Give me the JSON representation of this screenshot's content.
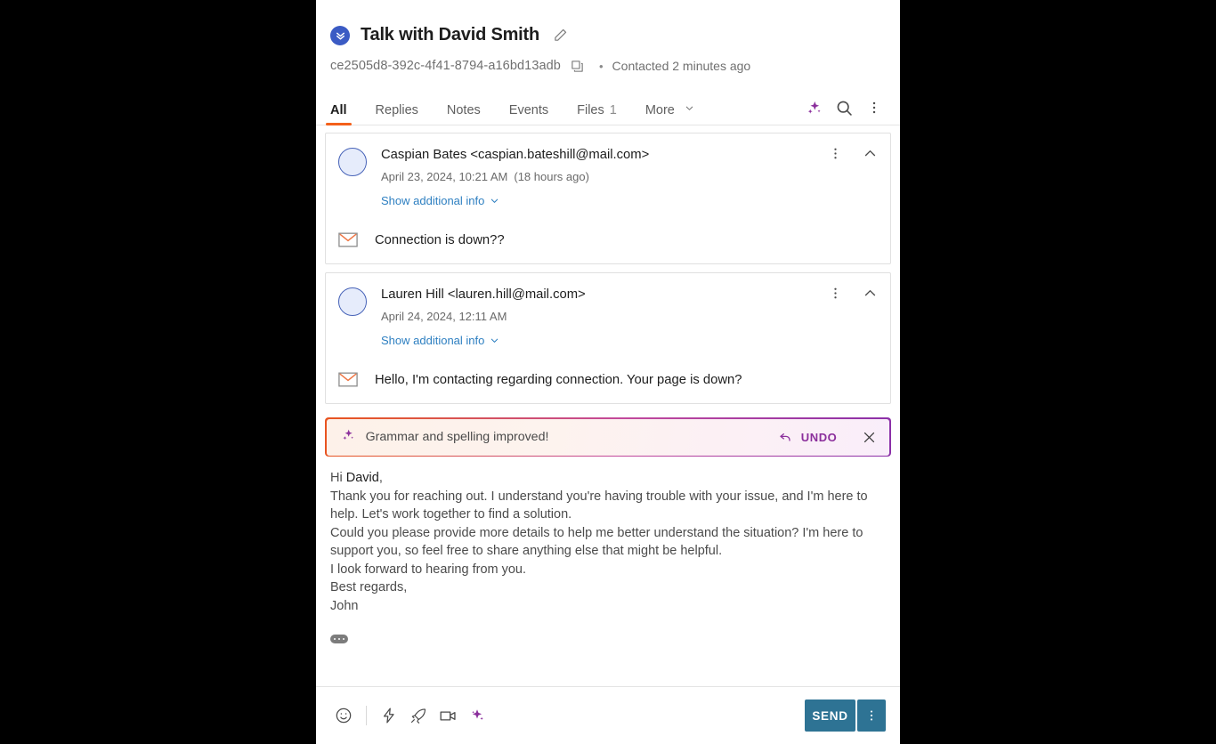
{
  "header": {
    "badge_icon": "double-chevron-down-icon",
    "title": "Talk with David Smith",
    "edit_icon": "pencil-icon",
    "conversation_id": "ce2505d8-392c-4f41-8794-a16bd13adb",
    "copy_icon": "copy-icon",
    "separator": "•",
    "contacted": "Contacted 2 minutes ago"
  },
  "tabs": {
    "items": [
      {
        "label": "All",
        "count": "",
        "active": true
      },
      {
        "label": "Replies",
        "count": "",
        "active": false
      },
      {
        "label": "Notes",
        "count": "",
        "active": false
      },
      {
        "label": "Events",
        "count": "",
        "active": false
      },
      {
        "label": "Files",
        "count": "1",
        "active": false
      },
      {
        "label": "More",
        "count": "",
        "active": false
      }
    ],
    "actions": [
      "ai-sparkle-icon",
      "search-icon",
      "kebab-menu-icon"
    ]
  },
  "thread": {
    "messages": [
      {
        "from": "Caspian Bates <caspian.bateshill@mail.com>",
        "date": "April 23, 2024, 10:21 AM",
        "relative": "(18 hours ago)",
        "show_info": "Show additional info",
        "text": "Connection is down??",
        "channel_icon": "envelope-icon"
      },
      {
        "from": "Lauren Hill <lauren.hill@mail.com>",
        "date": "April 24, 2024, 12:11 AM",
        "relative": "",
        "show_info": "Show additional info",
        "text": "Hello, I'm contacting regarding connection. Your page is down?",
        "channel_icon": "envelope-icon"
      }
    ]
  },
  "banner": {
    "icon": "ai-sparkle-icon",
    "text": "Grammar and spelling improved!",
    "undo_label": "UNDO",
    "undo_icon": "undo-arrow-icon",
    "close_icon": "close-icon",
    "border_gradient_start": "#e8541f",
    "border_gradient_end": "#8a2fa8",
    "accent_color": "#8b2f9c"
  },
  "composer": {
    "greeting_prefix": "Hi ",
    "greeting_token": "David",
    "greeting_suffix": ",",
    "lines": [
      "Thank you for reaching out. I understand you're having trouble with your issue, and I'm here to help. Let's work together to find a solution.",
      "Could you please provide more details to help me better understand the situation? I'm here to support you, so feel free to share anything else that might be helpful.",
      "I look forward to hearing from you.",
      "Best regards,",
      "John"
    ],
    "expand_icon": "ellipsis-pill-icon"
  },
  "footer": {
    "tools": [
      "emoji-icon",
      "lightning-icon",
      "rocket-icon",
      "video-camera-icon",
      "ai-sparkle-icon"
    ],
    "send_label": "SEND",
    "send_more_icon": "kebab-menu-icon",
    "send_color": "#2e7394"
  }
}
